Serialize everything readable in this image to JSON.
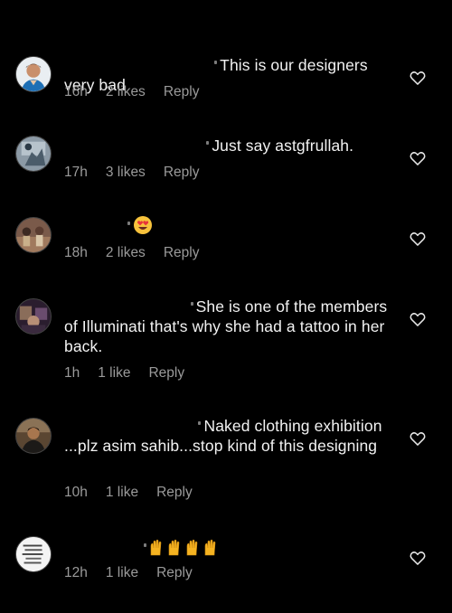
{
  "comments": [
    {
      "text": "This is our designers very bad",
      "time": "16h",
      "likes": "2 likes",
      "reply": "Reply"
    },
    {
      "text": "Just say astgfrullah.",
      "time": "17h",
      "likes": "3 likes",
      "reply": "Reply"
    },
    {
      "text": "",
      "emoji": "heart-eyes-emoji",
      "time": "18h",
      "likes": "2 likes",
      "reply": "Reply"
    },
    {
      "text": "She is one of the members of Illuminati that's why she had a tattoo in her back.",
      "time": "1h",
      "likes": "1 like",
      "reply": "Reply"
    },
    {
      "text": "Naked clothing exhibition ...plz asim sahib...stop kind of this designing",
      "time": "10h",
      "likes": "1 like",
      "reply": "Reply"
    },
    {
      "text": "",
      "emoji": "raised-hands-emoji",
      "time": "12h",
      "likes": "1 like",
      "reply": "Reply"
    }
  ],
  "colors": {
    "background": "#000000",
    "text": "#f2f2f2",
    "meta": "#9a9a9a"
  },
  "icons": {
    "like": "heart-outline-icon"
  }
}
